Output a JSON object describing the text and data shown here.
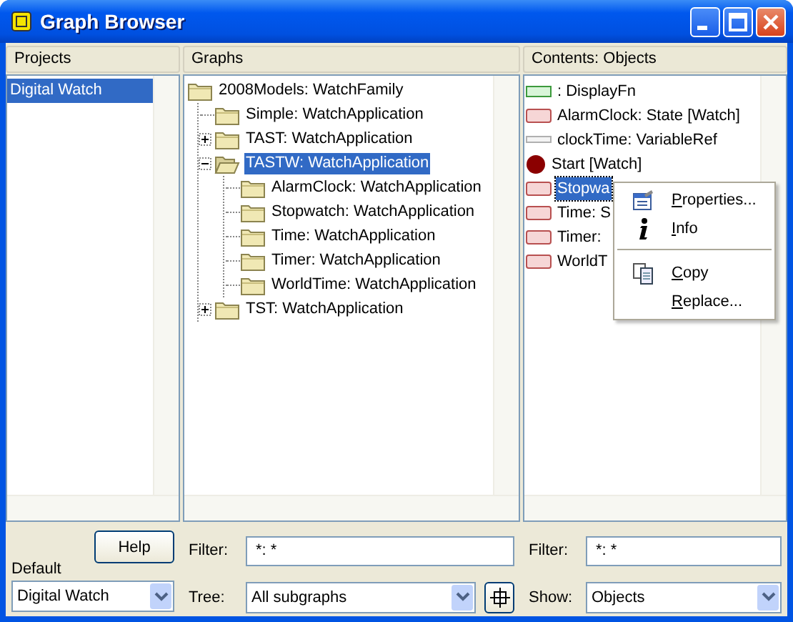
{
  "window": {
    "title": "Graph Browser"
  },
  "projects": {
    "header": "Projects",
    "items": [
      {
        "label": "Digital Watch",
        "selected": true
      }
    ],
    "help_button": "Help",
    "default_label": "Default",
    "default_value": "Digital Watch"
  },
  "graphs": {
    "header": "Graphs",
    "tree": [
      {
        "label": "2008Models: WatchFamily",
        "selected": false,
        "children": [
          {
            "label": "Simple: WatchApplication",
            "selected": false
          },
          {
            "label": "TAST: WatchApplication",
            "selected": false,
            "expanded": false
          },
          {
            "label": "TASTW: WatchApplication",
            "selected": true,
            "expanded": true,
            "children": [
              {
                "label": "AlarmClock: WatchApplication",
                "selected": false
              },
              {
                "label": "Stopwatch: WatchApplication",
                "selected": false
              },
              {
                "label": "Time: WatchApplication",
                "selected": false
              },
              {
                "label": "Timer: WatchApplication",
                "selected": false
              },
              {
                "label": "WorldTime: WatchApplication",
                "selected": false
              }
            ]
          },
          {
            "label": "TST: WatchApplication",
            "selected": false,
            "expanded": false
          }
        ]
      }
    ],
    "filter_label": "Filter:",
    "filter_value": "*: *",
    "tree_label": "Tree:",
    "tree_value": "All subgraphs"
  },
  "contents": {
    "header": "Contents: Objects",
    "items": [
      {
        "kind": "function",
        "label": ": DisplayFn",
        "selected": false
      },
      {
        "kind": "state",
        "label": "AlarmClock: State [Watch]",
        "selected": false
      },
      {
        "kind": "variable",
        "label": "clockTime: VariableRef",
        "selected": false
      },
      {
        "kind": "start",
        "label": "Start [Watch]",
        "selected": false
      },
      {
        "kind": "state",
        "label": "Stopwa",
        "selected": true
      },
      {
        "kind": "state",
        "label": "Time: S",
        "selected": false
      },
      {
        "kind": "state",
        "label": "Timer:",
        "selected": false
      },
      {
        "kind": "state",
        "label": "WorldT",
        "selected": false
      }
    ],
    "filter_label": "Filter:",
    "filter_value": "*: *",
    "show_label": "Show:",
    "show_value": "Objects"
  },
  "context_menu": [
    {
      "kind": "properties",
      "label": "Properties..."
    },
    {
      "kind": "info",
      "label": "Info"
    },
    {
      "kind": "separator"
    },
    {
      "kind": "copy",
      "label": "Copy"
    },
    {
      "kind": "plain",
      "label": "Replace..."
    }
  ]
}
